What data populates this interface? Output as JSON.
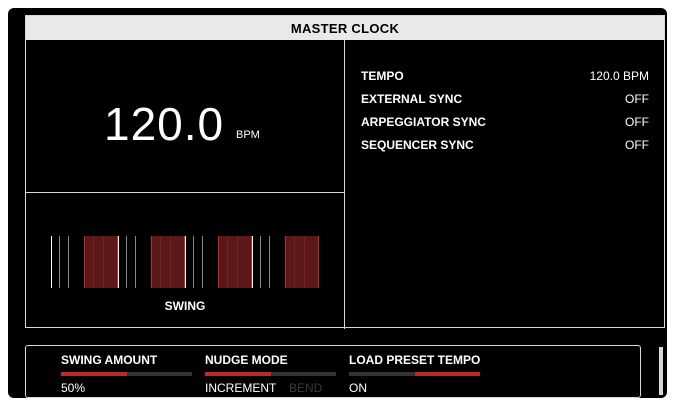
{
  "header": {
    "title": "MASTER CLOCK"
  },
  "tempo_display": {
    "value": "120.0",
    "unit": "BPM"
  },
  "params": [
    {
      "label": "TEMPO",
      "value": "120.0 BPM"
    },
    {
      "label": "EXTERNAL SYNC",
      "value": "OFF"
    },
    {
      "label": "ARPEGGIATOR SYNC",
      "value": "OFF"
    },
    {
      "label": "SEQUENCER SYNC",
      "value": "OFF"
    }
  ],
  "swing_panel": {
    "label": "SWING",
    "accent_color": "#c0282a",
    "block_color": "#5a1818"
  },
  "controls": {
    "swing_amount": {
      "label": "SWING AMOUNT",
      "value": "50%",
      "level": 0.5
    },
    "nudge_mode": {
      "label": "NUDGE MODE",
      "value": "INCREMENT",
      "alt_value": "BEND",
      "level": 0.5
    },
    "load_preset_tempo": {
      "label": "LOAD PRESET TEMPO",
      "value": "ON",
      "level": 0.5
    }
  }
}
